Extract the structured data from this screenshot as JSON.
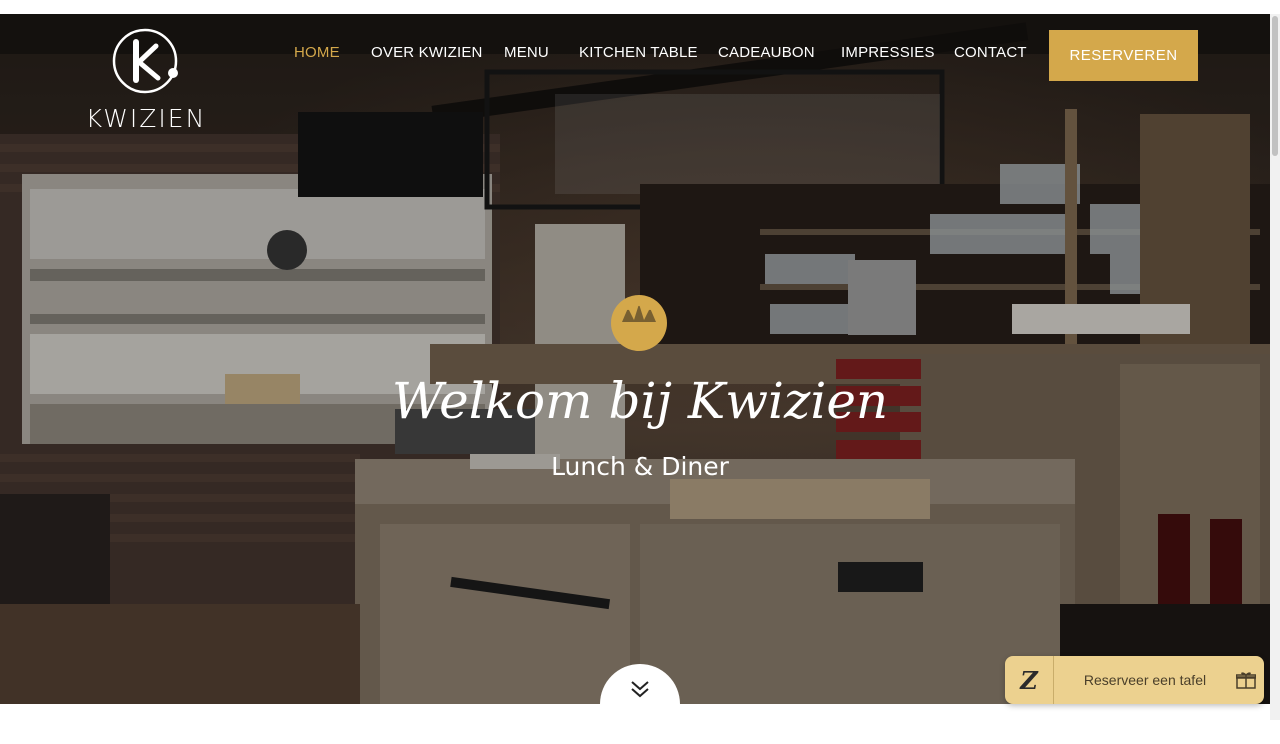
{
  "brand": {
    "name": "KWIZIEN"
  },
  "nav": {
    "items": [
      {
        "label": "HOME",
        "active": true
      },
      {
        "label": "OVER KWIZIEN",
        "active": false
      },
      {
        "label": "MENU",
        "active": false
      },
      {
        "label": "KITCHEN TABLE",
        "active": false
      },
      {
        "label": "CADEAUBON",
        "active": false
      },
      {
        "label": "IMPRESSIES",
        "active": false
      },
      {
        "label": "CONTACT",
        "active": false
      }
    ],
    "cta_label": "RESERVEREN"
  },
  "hero": {
    "title": "Welkom bij Kwizien",
    "subtitle": "Lunch & Diner"
  },
  "widget": {
    "label": "Reserveer een tafel",
    "logo_letter": "Z",
    "icon": "gift-icon"
  },
  "colors": {
    "accent": "#d4a84b",
    "widget_bg": "#ecd18f",
    "text_on_dark": "#ffffff"
  }
}
